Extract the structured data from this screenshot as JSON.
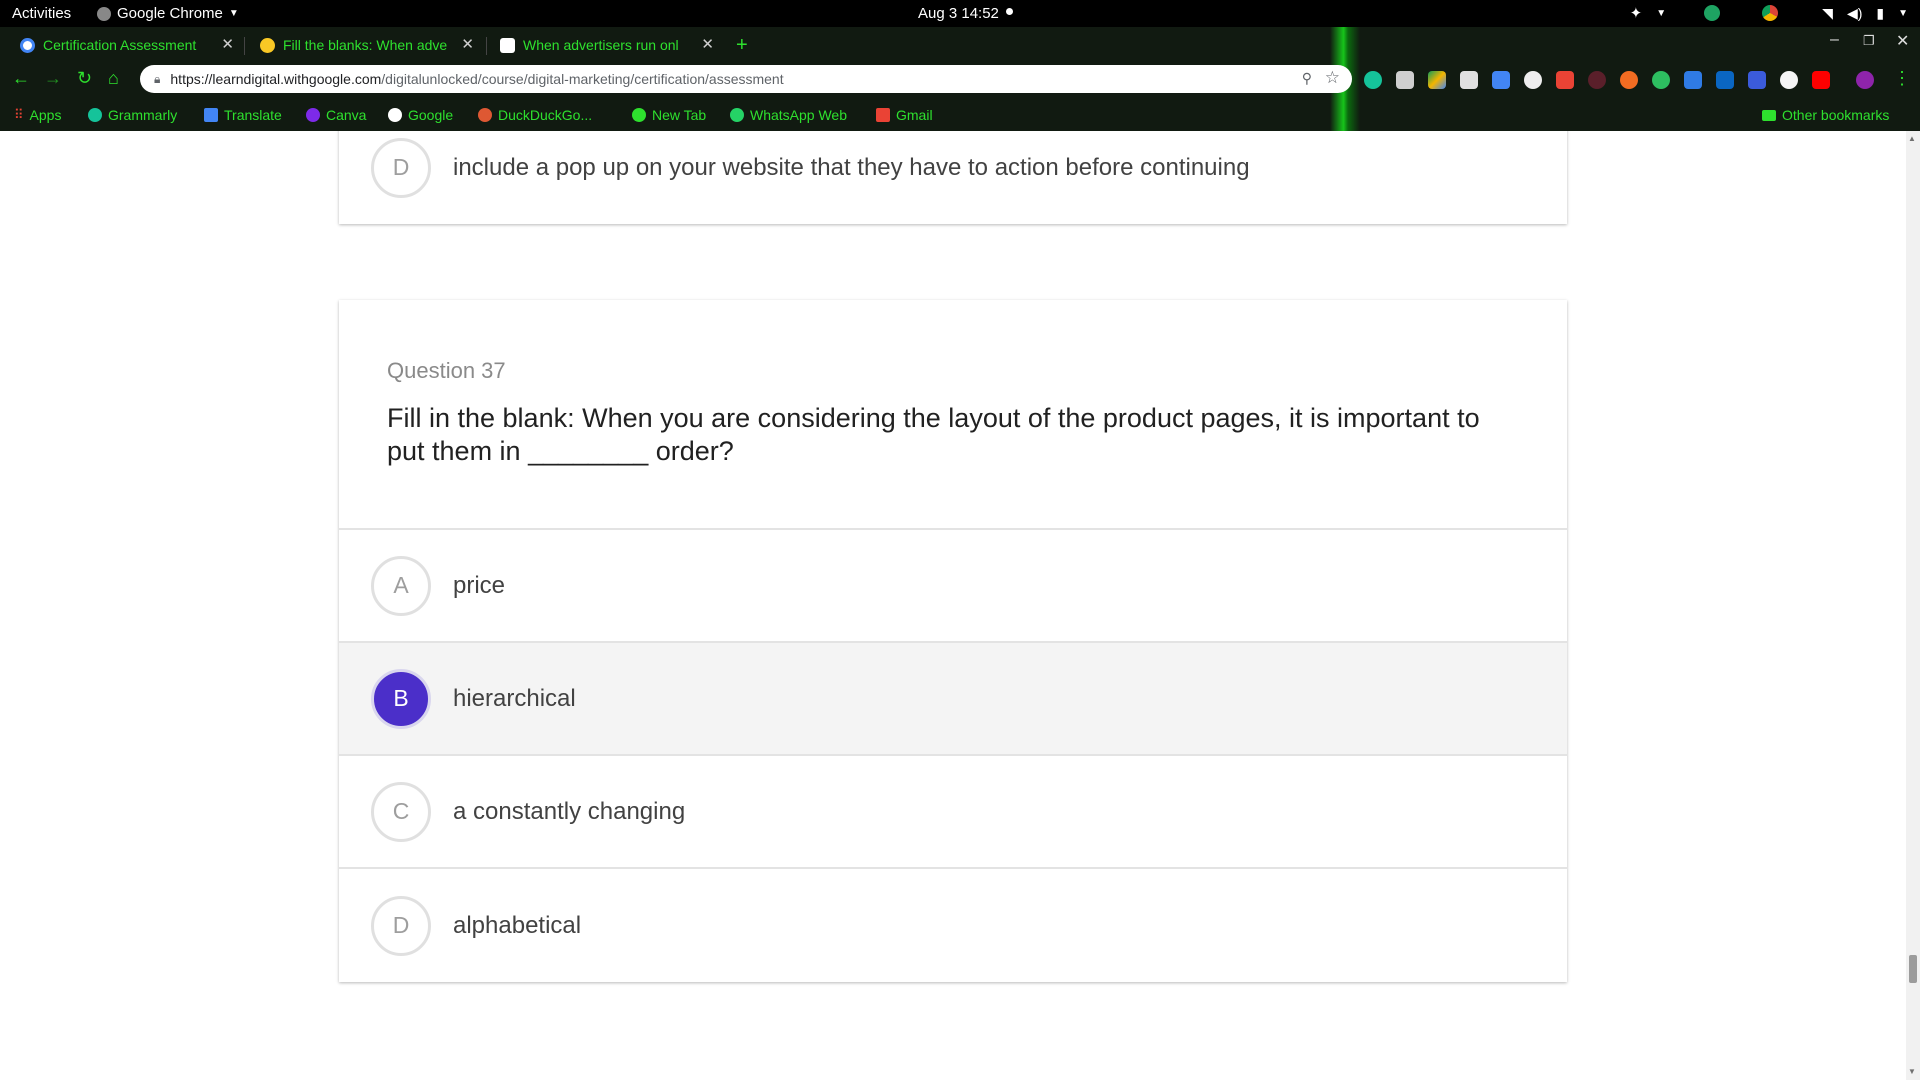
{
  "os_bar": {
    "activities": "Activities",
    "app_name": "Google Chrome",
    "clock": "Aug 3  14:52"
  },
  "tabs": [
    {
      "title": "Certification Assessment",
      "active": true
    },
    {
      "title": "Fill the blanks: When adve",
      "active": false
    },
    {
      "title": "When advertisers run onl",
      "active": false
    }
  ],
  "omnibox": {
    "url_host": "https://learndigital.withgoogle.com",
    "url_path": "/digitalunlocked/course/digital-marketing/certification/assessment"
  },
  "bookmarks": [
    {
      "label": "Apps",
      "color": "#e34133"
    },
    {
      "label": "Grammarly",
      "color": "#15c39a"
    },
    {
      "label": "Translate",
      "color": "#4285f4"
    },
    {
      "label": "Canva",
      "color": "#7d2ae8"
    },
    {
      "label": "Google",
      "color": "#ffffff"
    },
    {
      "label": "DuckDuckGo...",
      "color": "#de5833"
    },
    {
      "label": "New Tab",
      "color": "#2ee02e"
    },
    {
      "label": "WhatsApp Web",
      "color": "#25d366"
    },
    {
      "label": "Gmail",
      "color": "#ea4335"
    }
  ],
  "other_bookmarks": "Other bookmarks",
  "previous_question": {
    "option_d": {
      "letter": "D",
      "text": "include a pop up on your website that they have to action before continuing"
    }
  },
  "question": {
    "number_label": "Question 37",
    "text": "Fill in the blank: When you are considering the layout of the product pages, it is important to put them in ________ order?",
    "options": [
      {
        "letter": "A",
        "text": "price",
        "selected": false
      },
      {
        "letter": "B",
        "text": "hierarchical",
        "selected": true
      },
      {
        "letter": "C",
        "text": "a constantly changing",
        "selected": false
      },
      {
        "letter": "D",
        "text": "alphabetical",
        "selected": false
      }
    ]
  },
  "colors": {
    "accent_selected": "#4b2fc9",
    "chrome_theme_text": "#2ee02e"
  }
}
